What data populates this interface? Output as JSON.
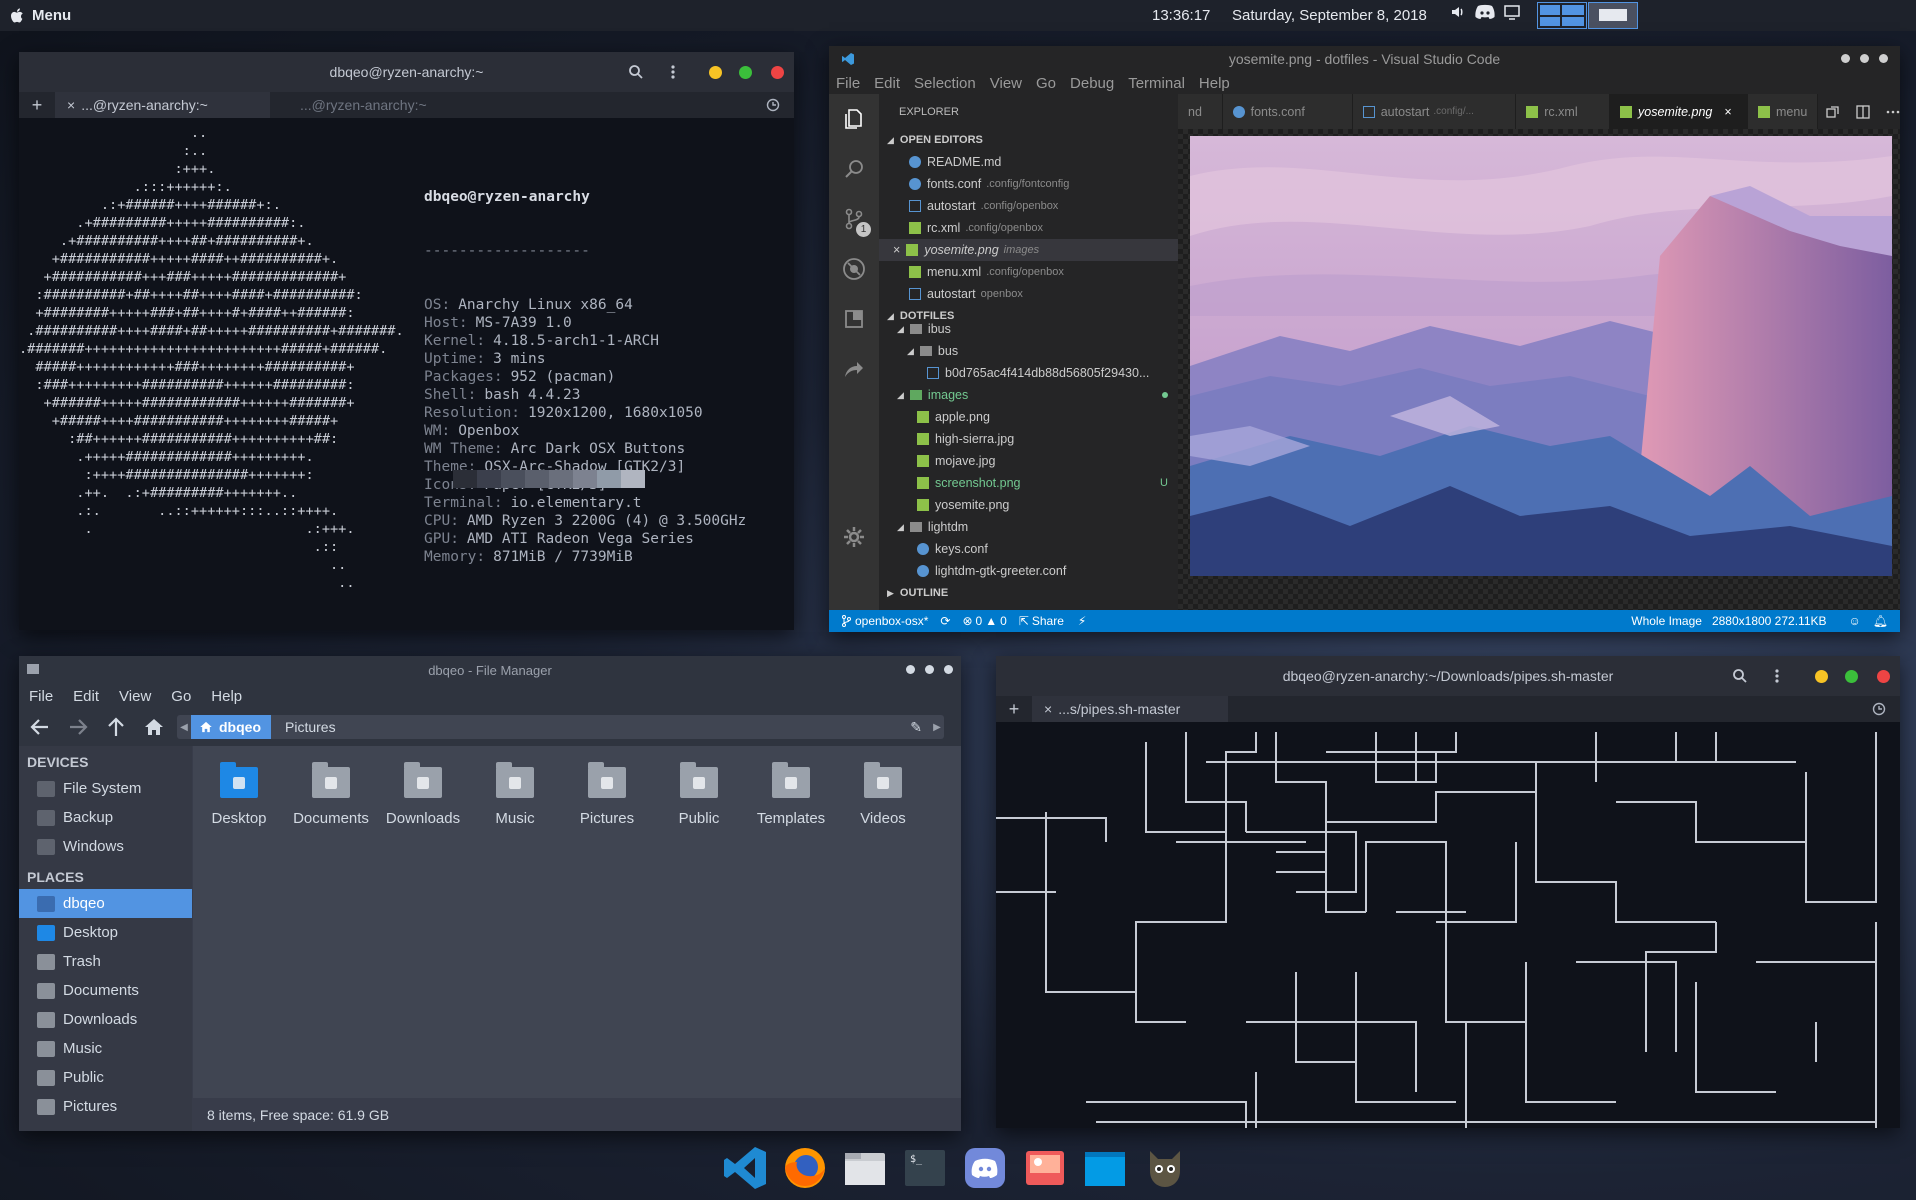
{
  "top_panel": {
    "menu_label": "Menu",
    "clock": "13:36:17",
    "date": "Saturday, September 8, 2018"
  },
  "terminal1": {
    "title": "dbqeo@ryzen-anarchy:~",
    "tabs": [
      "...@ryzen-anarchy:~",
      "...@ryzen-anarchy:~"
    ],
    "ascii_art": "                     ..\n                    :..\n                   :+++.\n              .:::++++++:.\n          .:+######++++######+:.\n       .+#########+++++##########:.\n     .+##########++++##+##########+.\n    +###########+++++####++##########+.\n   +###########+++###+++++#############+\n  :##########+##++++##++++####+##########:\n  +########+++++###+##++++#+####++######:\n .##########++++####+##+++++##########+#######.\n.#######++++++++++++++++++++++++#####+######.\n  #####++++++++++++###++++++++##########+\n  :###+++++++++##########++++++#########:\n   +######+++++############++++++#######+\n    +#####++++###########++++++++#####+\n      :##++++++###########++++++++++##:\n       .+++++#############+++++++++.\n        :++++###############+++++++:\n       .++.  .:+#########+++++++..\n       .:.       ..::++++++:::..::++++.\n        .                          .:+++.\n                                    .::\n                                      ..\n                                       ..",
    "user_host": "dbqeo@ryzen-anarchy",
    "separator": "-------------------",
    "info": [
      {
        "key": "OS:",
        "value": "Anarchy Linux x86_64"
      },
      {
        "key": "Host:",
        "value": "MS-7A39 1.0"
      },
      {
        "key": "Kernel:",
        "value": "4.18.5-arch1-1-ARCH"
      },
      {
        "key": "Uptime:",
        "value": "3 mins"
      },
      {
        "key": "Packages:",
        "value": "952 (pacman)"
      },
      {
        "key": "Shell:",
        "value": "bash 4.4.23"
      },
      {
        "key": "Resolution:",
        "value": "1920x1200, 1680x1050"
      },
      {
        "key": "WM:",
        "value": "Openbox"
      },
      {
        "key": "WM Theme:",
        "value": "Arc Dark OSX Buttons"
      },
      {
        "key": "Theme:",
        "value": "OSX-Arc-Shadow [GTK2/3]"
      },
      {
        "key": "Icons:",
        "value": "Paper [GTK2/3]"
      },
      {
        "key": "Terminal:",
        "value": "io.elementary.t"
      },
      {
        "key": "CPU:",
        "value": "AMD Ryzen 3 2200G (4) @ 3.500GHz"
      },
      {
        "key": "GPU:",
        "value": "AMD ATI Radeon Vega Series"
      },
      {
        "key": "Memory:",
        "value": "871MiB / 7739MiB"
      }
    ],
    "palette": [
      "#2b2e37",
      "#3b3f4c",
      "#4a4f5c",
      "#5a5f6c",
      "#6a6f7c",
      "#7d8290",
      "#909ba8",
      "#b0b5c0"
    ]
  },
  "vscode": {
    "title": "yosemite.png - dotfiles - Visual Studio Code",
    "menu": [
      "File",
      "Edit",
      "Selection",
      "View",
      "Go",
      "Debug",
      "Terminal",
      "Help"
    ],
    "explorer_label": "EXPLORER",
    "open_editors_label": "OPEN EDITORS",
    "open_editors": [
      {
        "name": "README.md",
        "desc": "",
        "icon": "info-icon"
      },
      {
        "name": "fonts.conf",
        "desc": ".config/fontconfig",
        "icon": "gear-icon"
      },
      {
        "name": "autostart",
        "desc": ".config/openbox",
        "icon": "file-icon"
      },
      {
        "name": "rc.xml",
        "desc": ".config/openbox",
        "icon": "xml-icon"
      },
      {
        "name": "yosemite.png",
        "desc": "images",
        "icon": "image-icon"
      },
      {
        "name": "menu.xml",
        "desc": ".config/openbox",
        "icon": "xml-icon"
      },
      {
        "name": "autostart",
        "desc": "openbox",
        "icon": "file-icon"
      }
    ],
    "dotfiles_label": "DOTFILES",
    "tree": [
      {
        "name": "ibus",
        "level": 1,
        "type": "folder"
      },
      {
        "name": "bus",
        "level": 2,
        "type": "folder"
      },
      {
        "name": "b0d765ac4f414db88d56805f29430...",
        "level": 3,
        "type": "file"
      },
      {
        "name": "images",
        "level": 1,
        "type": "folder-green"
      },
      {
        "name": "apple.png",
        "level": 2,
        "type": "image"
      },
      {
        "name": "high-sierra.jpg",
        "level": 2,
        "type": "image"
      },
      {
        "name": "mojave.jpg",
        "level": 2,
        "type": "image"
      },
      {
        "name": "screenshot.png",
        "level": 2,
        "type": "image-green",
        "badge": "U"
      },
      {
        "name": "yosemite.png",
        "level": 2,
        "type": "image"
      },
      {
        "name": "lightdm",
        "level": 1,
        "type": "folder"
      },
      {
        "name": "keys.conf",
        "level": 2,
        "type": "gear"
      },
      {
        "name": "lightdm-gtk-greeter.conf",
        "level": 2,
        "type": "gear"
      }
    ],
    "outline_label": "OUTLINE",
    "tabs": [
      "nd",
      "fonts.conf",
      "autostart",
      "rc.xml",
      "yosemite.png",
      "menu"
    ],
    "tab_autostart_desc": ".config/...",
    "scm_badge": "1",
    "status": {
      "branch": "openbox-osx*",
      "errors": "0",
      "warnings": "0",
      "share": "Share",
      "whole_image": "Whole Image",
      "image_info": "2880x1800 272.11KB"
    }
  },
  "file_manager": {
    "title": "dbqeo - File Manager",
    "menu": [
      "File",
      "Edit",
      "View",
      "Go",
      "Help"
    ],
    "path": [
      "dbqeo",
      "Pictures"
    ],
    "devices_label": "DEVICES",
    "devices": [
      "File System",
      "Backup",
      "Windows"
    ],
    "places_label": "PLACES",
    "places": [
      "dbqeo",
      "Desktop",
      "Trash",
      "Documents",
      "Downloads",
      "Music",
      "Public",
      "Pictures"
    ],
    "folders": [
      "Desktop",
      "Documents",
      "Downloads",
      "Music",
      "Pictures",
      "Public",
      "Templates",
      "Videos"
    ],
    "status": "8 items, Free space: 61.9 GB"
  },
  "terminal2": {
    "title": "dbqeo@ryzen-anarchy:~/Downloads/pipes.sh-master",
    "tab": "...s/pipes.sh-master"
  },
  "dock": [
    "vscode-icon",
    "firefox-icon",
    "files-icon",
    "terminal-icon",
    "discord-icon",
    "image-viewer-icon",
    "window-icon",
    "gimp-icon"
  ]
}
